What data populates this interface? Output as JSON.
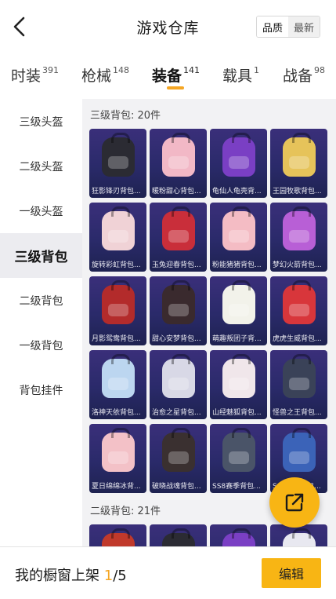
{
  "header": {
    "title": "游戏仓库",
    "sort_options": [
      "品质",
      "最新"
    ],
    "active_sort": "品质"
  },
  "tabs": [
    {
      "label": "时装",
      "count": "391"
    },
    {
      "label": "枪械",
      "count": "148"
    },
    {
      "label": "装备",
      "count": "141"
    },
    {
      "label": "载具",
      "count": "1"
    },
    {
      "label": "战备",
      "count": "98"
    }
  ],
  "active_tab": "装备",
  "sidebar": {
    "items": [
      "三级头盔",
      "二级头盔",
      "一级头盔",
      "三级背包",
      "二级背包",
      "一级背包",
      "背包挂件"
    ],
    "active": "三级背包"
  },
  "sections": [
    {
      "title": "三级背包: 20件",
      "items": [
        {
          "label": "狂影锋刃背包...",
          "color": "#2b2b33"
        },
        {
          "label": "暖粉甜心背包...",
          "color": "#f2b8c6"
        },
        {
          "label": "龟仙人龟壳背...",
          "color": "#7a3fc4"
        },
        {
          "label": "王园牧歌背包...",
          "color": "#e6c35a"
        },
        {
          "label": "旋转彩虹背包...",
          "color": "#f0d2d6"
        },
        {
          "label": "玉兔迎春背包...",
          "color": "#c92e3a"
        },
        {
          "label": "粉能猪猪背包...",
          "color": "#f4bcc4"
        },
        {
          "label": "梦幻火箭背包...",
          "color": "#b85fd6"
        },
        {
          "label": "月影鸳鸯背包...",
          "color": "#b32b2b"
        },
        {
          "label": "甜心安梦背包...",
          "color": "#3a2a2e"
        },
        {
          "label": "萌趣叛团子背...",
          "color": "#f2f2ea"
        },
        {
          "label": "虎虎生威背包...",
          "color": "#d8363b"
        },
        {
          "label": "洛神天依背包...",
          "color": "#bcd6f0"
        },
        {
          "label": "治愈之星背包...",
          "color": "#d8d8e6"
        },
        {
          "label": "山经魅狐背包...",
          "color": "#f0e6ea"
        },
        {
          "label": "怪兽之王背包...",
          "color": "#3a4258"
        },
        {
          "label": "夏日绵绵冰背...",
          "color": "#f3c1c7"
        },
        {
          "label": "破晓战魂背包...",
          "color": "#3a3030"
        },
        {
          "label": "SS8赛季背包...",
          "color": "#4a5468"
        },
        {
          "label": "SS7赛季背包...",
          "color": "#3b63b8"
        }
      ]
    },
    {
      "title": "二级背包: 21件",
      "items": [
        {
          "label": "",
          "color": "#c0392b"
        },
        {
          "label": "",
          "color": "#2b2b33"
        },
        {
          "label": "",
          "color": "#7a3fc4"
        },
        {
          "label": "",
          "color": "#e8e8f0"
        }
      ]
    }
  ],
  "showcase": {
    "prefix": "我的橱窗上架",
    "current": "1",
    "total": "/5",
    "edit_label": "编辑"
  },
  "icons": {
    "back": "chevron-left-icon",
    "share": "share-external-icon"
  },
  "colors": {
    "accent": "#f8b514",
    "card_bg": "#2a2a6a"
  }
}
